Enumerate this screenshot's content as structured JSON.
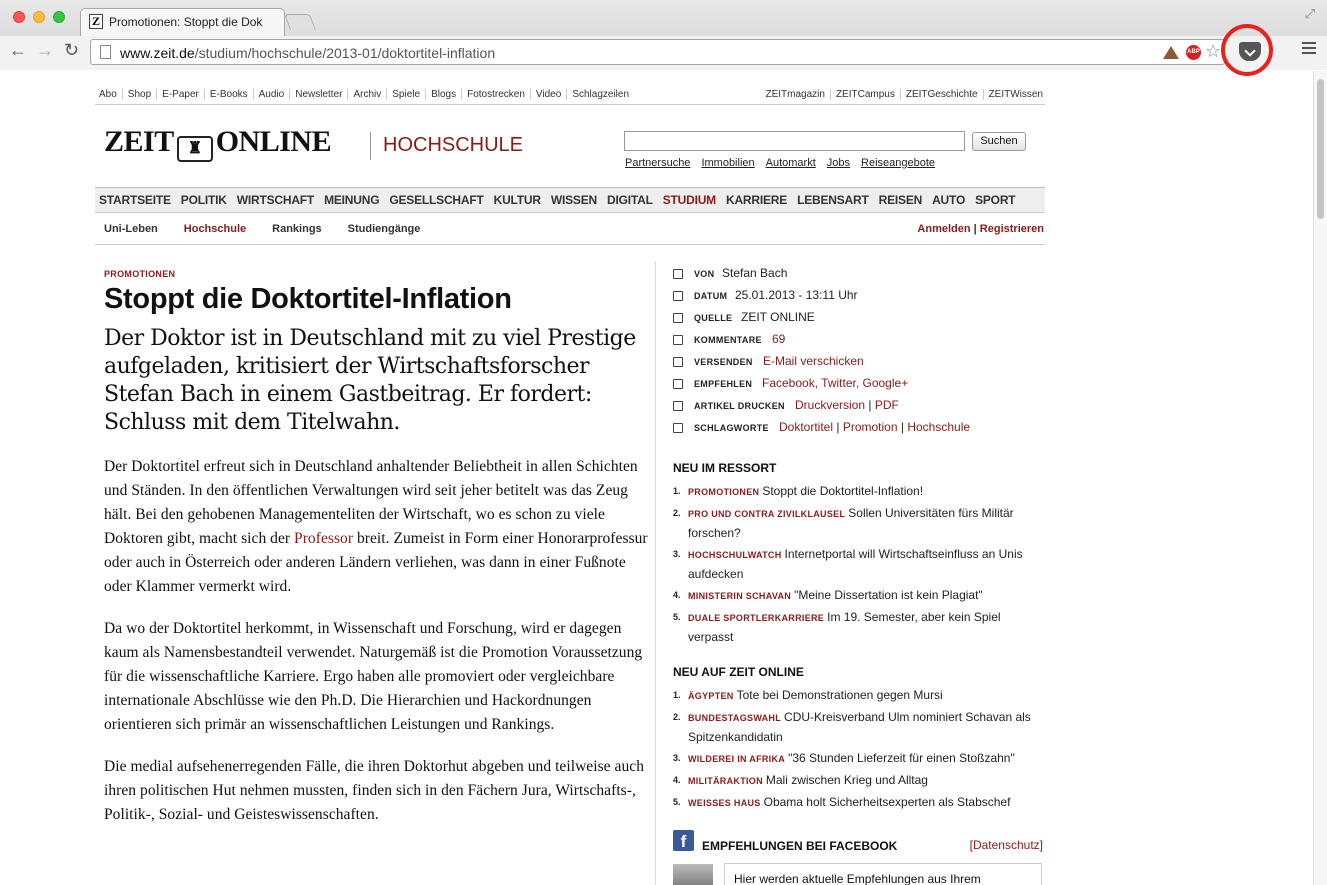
{
  "browser": {
    "tab_title": "Promotionen: Stoppt die Dok",
    "tab_favicon": "Z",
    "url_domain": "www.zeit.de",
    "url_path": "/studium/hochschule/2013-01/doktortitel-inflation",
    "icons": [
      "back-arrow-icon",
      "forward-arrow-icon",
      "reload-icon",
      "page-icon",
      "extension-icon",
      "adblock-icon",
      "star-icon",
      "pocket-icon",
      "menu-icon"
    ],
    "abp_label": "ABP",
    "highlight_color": "#e8231f"
  },
  "topnav": {
    "left": [
      "Abo",
      "Shop",
      "E-Paper",
      "E-Books",
      "Audio",
      "Newsletter",
      "Archiv",
      "Spiele",
      "Blogs",
      "Fotostrecken",
      "Video",
      "Schlagzeilen"
    ],
    "right": [
      "ZEITmagazin",
      "ZEITCampus",
      "ZEITGeschichte",
      "ZEITWissen"
    ]
  },
  "header": {
    "logo_left": "ZEIT",
    "logo_right": "ONLINE",
    "section": "HOCHSCHULE",
    "search_button": "Suchen",
    "quicklinks": [
      "Partnersuche",
      "Immobilien",
      "Automarkt",
      "Jobs",
      "Reiseangebote"
    ]
  },
  "mainnav": [
    "STARTSEITE",
    "POLITIK",
    "WIRTSCHAFT",
    "MEINUNG",
    "GESELLSCHAFT",
    "KULTUR",
    "WISSEN",
    "DIGITAL",
    "STUDIUM",
    "KARRIERE",
    "LEBENSART",
    "REISEN",
    "AUTO",
    "SPORT"
  ],
  "mainnav_active": "STUDIUM",
  "subnav": {
    "items": [
      "Uni-Leben",
      "Hochschule",
      "Rankings",
      "Studiengänge"
    ],
    "active": "Hochschule",
    "login": "Anmelden",
    "sep": "|",
    "register": "Registrieren"
  },
  "article": {
    "kicker": "PROMOTIONEN",
    "headline": "Stoppt die Doktortitel-Inflation",
    "summary": "Der Doktor ist in Deutschland mit zu viel Prestige aufgeladen, kritisiert der Wirtschaftsforscher Stefan Bach in einem Gastbeitrag. Er fordert: Schluss mit dem Titelwahn.",
    "p1_a": "Der Doktortitel erfreut sich in Deutschland anhaltender Beliebtheit in allen Schichten und Ständen. In den öffentlichen Verwaltungen wird seit jeher betitelt was das Zeug hält. Bei den gehobenen Managementeliten der Wirtschaft, wo es schon zu viele Doktoren gibt, macht sich der ",
    "p1_link": "Professor",
    "p1_b": " breit. Zumeist in Form einer Honorarprofessur oder auch in Österreich oder anderen Ländern verliehen, was dann in einer Fußnote oder Klammer vermerkt wird.",
    "p2": "Da wo der Doktortitel herkommt, in Wissenschaft und Forschung, wird er dagegen kaum als Namensbestandteil verwendet. Naturgemäß ist die Promotion Voraussetzung für die wissenschaftliche Karriere. Ergo haben alle promoviert oder vergleichbare internationale Abschlüsse wie den Ph.D. Die Hierarchien und Hackordnungen orientieren sich primär an wissenschaftlichen Leistungen und Rankings.",
    "p3": "Die medial aufsehenerregenden Fälle, die ihren Doktorhut abgeben und teilweise auch ihren politischen Hut nehmen mussten, finden sich in den Fächern Jura, Wirtschafts-, Politik-, Sozial- und Geisteswissenschaften."
  },
  "meta": {
    "von_label": "VON",
    "von": "Stefan Bach",
    "datum_label": "DATUM",
    "datum": "25.01.2013 - 13:11 Uhr",
    "quelle_label": "QUELLE",
    "quelle": "ZEIT ONLINE",
    "kommentare_label": "KOMMENTARE",
    "kommentare": "69",
    "versenden_label": "VERSENDEN",
    "versenden": "E-Mail verschicken",
    "empfehlen_label": "EMPFEHLEN",
    "empfehlen": "Facebook, Twitter, Google+",
    "drucken_label": "ARTIKEL DRUCKEN",
    "drucken_1": "Druckversion",
    "drucken_sep": "|",
    "drucken_2": "PDF",
    "schlagworte_label": "SCHLAGWORTE",
    "sw_1": "Doktortitel",
    "sw_2": "Promotion",
    "sw_3": "Hochschule"
  },
  "ressort": {
    "title": "NEU IM RESSORT",
    "items": [
      {
        "num": "1.",
        "kicker": "PROMOTIONEN",
        "text": "Stoppt die Doktortitel-Inflation!"
      },
      {
        "num": "2.",
        "kicker": "PRO UND CONTRA ZIVILKLAUSEL",
        "text": "Sollen Universitäten fürs Militär forschen?"
      },
      {
        "num": "3.",
        "kicker": "HOCHSCHULWATCH",
        "text": "Internetportal will Wirtschaftseinfluss an Unis aufdecken"
      },
      {
        "num": "4.",
        "kicker": "MINISTERIN SCHAVAN",
        "text": "\"Meine Dissertation ist kein Plagiat\""
      },
      {
        "num": "5.",
        "kicker": "DUALE SPORTLERKARRIERE",
        "text": "Im 19. Semester, aber kein Spiel verpasst"
      }
    ]
  },
  "neu": {
    "title": "NEU AUF ZEIT ONLINE",
    "items": [
      {
        "num": "1.",
        "kicker": "ÄGYPTEN",
        "text": "Tote bei Demonstrationen gegen Mursi"
      },
      {
        "num": "2.",
        "kicker": "BUNDESTAGSWAHL",
        "text": "CDU-Kreisverband Ulm nominiert Schavan als Spitzenkandidatin"
      },
      {
        "num": "3.",
        "kicker": "WILDEREI IN AFRIKA",
        "text": "\"36 Stunden Lieferzeit für einen Stoßzahn\""
      },
      {
        "num": "4.",
        "kicker": "MILITÄRAKTION",
        "text": "Mali zwischen Krieg und Alltag"
      },
      {
        "num": "5.",
        "kicker": "WEISSES HAUS",
        "text": "Obama holt Sicherheitsexperten als Stabschef"
      }
    ]
  },
  "facebook": {
    "title": "EMPFEHLUNGEN BEI FACEBOOK",
    "privacy": "[Datenschutz]",
    "widget_text": "Hier werden aktuelle Empfehlungen aus Ihrem",
    "icon_letter": "f"
  }
}
